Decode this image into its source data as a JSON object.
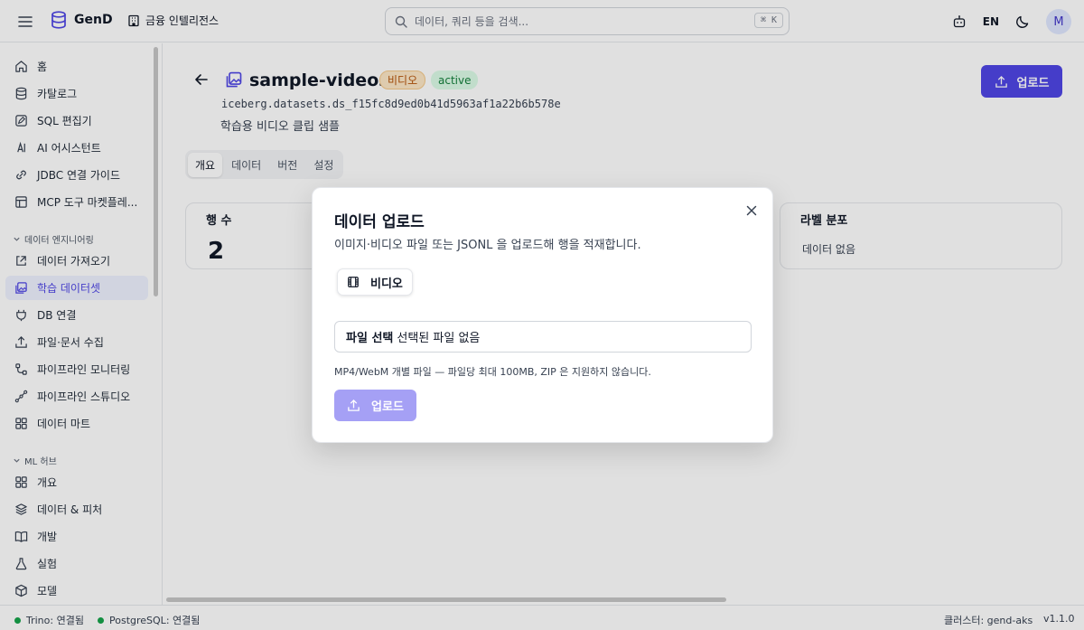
{
  "app": {
    "name": "GenD",
    "org": "금융 인텔리전스"
  },
  "search": {
    "placeholder": "데이터, 쿼리 등을 검색...",
    "shortcut": "⌘ K"
  },
  "header": {
    "lang": "EN",
    "avatar": "M"
  },
  "sidebar": {
    "items_top": [
      {
        "label": "홈",
        "icon": "home-icon"
      },
      {
        "label": "카탈로그",
        "icon": "database-icon"
      },
      {
        "label": "SQL 편집기",
        "icon": "edit-icon"
      },
      {
        "label": "AI 어시스턴트",
        "icon": "ai-icon"
      },
      {
        "label": "JDBC 연결 가이드",
        "icon": "link-icon"
      },
      {
        "label": "MCP 도구 마켓플레...",
        "icon": "store-icon"
      }
    ],
    "section_de": "데이터 엔지니어링",
    "items_de": [
      {
        "label": "데이터 가져오기",
        "icon": "import-icon"
      },
      {
        "label": "학습 데이터셋",
        "icon": "image-dataset-icon",
        "active": true
      },
      {
        "label": "DB 연결",
        "icon": "plug-icon"
      },
      {
        "label": "파일·문서 수집",
        "icon": "upload-icon"
      },
      {
        "label": "파이프라인 모니터링",
        "icon": "pipeline-icon"
      },
      {
        "label": "파이프라인 스튜디오",
        "icon": "workflow-icon"
      },
      {
        "label": "데이터 마트",
        "icon": "grid-icon"
      }
    ],
    "section_ml": "ML 허브",
    "items_ml": [
      {
        "label": "개요",
        "icon": "grid-icon"
      },
      {
        "label": "데이터 & 피처",
        "icon": "layers-icon"
      },
      {
        "label": "개발",
        "icon": "book-icon"
      },
      {
        "label": "실험",
        "icon": "flask-icon"
      },
      {
        "label": "모델",
        "icon": "box-icon"
      }
    ]
  },
  "dataset": {
    "title": "sample-videos",
    "badge_type": "비디오",
    "badge_status": "active",
    "path": "iceberg.datasets.ds_f15fc8d9ed0b41d5963af1a22b6b578e",
    "description": "학습용 비디오 클립 샘플",
    "upload_label": "업로드",
    "tabs": [
      "개요",
      "데이터",
      "버전",
      "설정"
    ],
    "rows_card": {
      "title": "행 수",
      "value": "2"
    },
    "label_card": {
      "title": "라벨 분포",
      "text": "데이터 없음"
    }
  },
  "modal": {
    "title": "데이터 업로드",
    "description": "이미지·비디오 파일 또는 JSONL 을 업로드해 행을 적재합니다.",
    "type_label": "비디오",
    "file_button": "파일 선택",
    "file_status": "선택된 파일 없음",
    "hint": "MP4/WebM 개별 파일 — 파일당 최대 100MB, ZIP 은 지원하지 않습니다.",
    "upload_label": "업로드"
  },
  "status": {
    "trino": "Trino: 연결됨",
    "postgres": "PostgreSQL: 연결됨",
    "cluster": "클러스터: gend-aks",
    "version": "v1.1.0"
  },
  "colors": {
    "accent": "#4f46e5",
    "connected": "#16a34a"
  }
}
